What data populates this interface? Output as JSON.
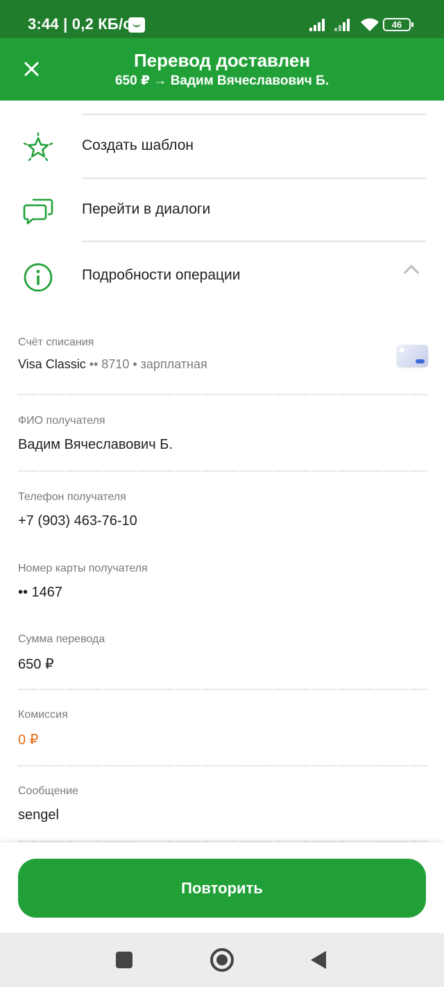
{
  "status_bar": {
    "time": "3:44 | 0,2 КБ/с",
    "battery": "46"
  },
  "header": {
    "title": "Перевод доставлен",
    "subtitle": "650 ₽ → Вадим Вячеславович Б."
  },
  "actions": [
    {
      "label": "Создать шаблон",
      "icon": "star-icon"
    },
    {
      "label": "Перейти в диалоги",
      "icon": "chat-icon"
    },
    {
      "label": "Подробности операции",
      "icon": "info-icon"
    }
  ],
  "details": {
    "account": {
      "label": "Счёт списания",
      "card_name": "Visa Classic",
      "card_number": " •• 8710",
      "card_type": " • зарплатная"
    },
    "recipient_name": {
      "label": "ФИО получателя",
      "value": "Вадим Вячеславович Б."
    },
    "recipient_phone": {
      "label": "Телефон получателя",
      "value": "+7 (903) 463-76-10"
    },
    "recipient_card": {
      "label": "Номер карты получателя",
      "value": "•• 1467"
    },
    "amount": {
      "label": "Сумма перевода",
      "value": "650 ₽"
    },
    "fee": {
      "label": "Комиссия",
      "value": "0 ₽"
    },
    "message": {
      "label": "Сообщение",
      "value": "sengel"
    }
  },
  "repeat_button": "Повторить",
  "colors": {
    "status_bar": "#1f7d2c",
    "brand_green": "#21a038",
    "fee_orange": "#e3701b"
  }
}
